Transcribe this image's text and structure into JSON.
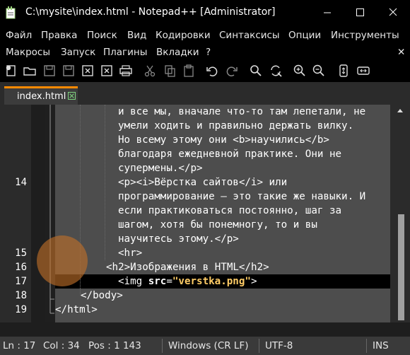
{
  "window": {
    "title": "C:\\mysite\\index.html - Notepad++ [Administrator]"
  },
  "menu": {
    "row1": [
      "Файл",
      "Правка",
      "Поиск",
      "Вид",
      "Кодировки",
      "Синтаксисы",
      "Опции",
      "Инструменты"
    ],
    "row2": [
      "Макросы",
      "Запуск",
      "Плагины",
      "Вкладки",
      "?"
    ],
    "close_glyph": "✕"
  },
  "toolbar": {
    "icons": [
      "new-file-icon",
      "open-file-icon",
      "save-icon",
      "save-all-icon",
      "close-icon",
      "close-all-icon",
      "print-icon",
      "cut-icon",
      "copy-icon",
      "paste-icon",
      "undo-icon",
      "redo-icon",
      "find-icon",
      "replace-icon",
      "zoom-in-icon",
      "zoom-out-icon",
      "sync-vertical-icon",
      "sync-horizontal-icon"
    ]
  },
  "tab": {
    "label": "index.html"
  },
  "editor": {
    "line_numbers": [
      "14",
      "15",
      "16",
      "17",
      "18",
      "19"
    ],
    "lines": [
      "и все мы, вначале что-то там лепетали, не",
      "умели ходить и правильно держать вилку.",
      "Но всему этому они <b>научились</b>",
      "благодаря ежедневной практике. Они не",
      "супермены.</p>",
      "<p><i>Вёрстка сайтов</i> или",
      "программирование — это такие же навыки. И",
      "если практиковаться постоянно, шаг за",
      "шагом, хотя бы понемногу, то и вы",
      "научитесь этому.</p>",
      "<hr>",
      "<h2>Изображения в HTML</h2>",
      "</body>",
      "</html>"
    ],
    "img_line": {
      "open": "<img ",
      "attr": "src",
      "eq": "=",
      "value": "\"verstka.png\"",
      "close": ">"
    }
  },
  "status": {
    "ln": "Ln : 17",
    "col": "Col : 34",
    "pos": "Pos : 1 143",
    "eol": "Windows (CR LF)",
    "encoding": "UTF-8",
    "mode": "INS"
  },
  "colors": {
    "tab_accent": "#ff8a00",
    "string": "#ffcc66",
    "text_area": "#4d4d4d",
    "current_line": "#000000"
  }
}
